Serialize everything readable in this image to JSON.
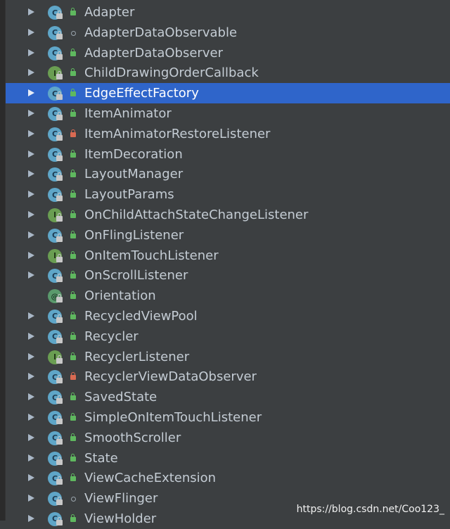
{
  "tree": {
    "items": [
      {
        "label": "Adapter",
        "icon": "class-icon",
        "icon_letter": "C",
        "visibility": "public",
        "expandable": true,
        "selected": false
      },
      {
        "label": "AdapterDataObservable",
        "icon": "class-icon",
        "icon_letter": "C",
        "visibility": "package",
        "expandable": true,
        "selected": false
      },
      {
        "label": "AdapterDataObserver",
        "icon": "class-icon",
        "icon_letter": "C",
        "visibility": "public",
        "expandable": true,
        "selected": false
      },
      {
        "label": "ChildDrawingOrderCallback",
        "icon": "interface-icon",
        "icon_letter": "I",
        "visibility": "public",
        "expandable": true,
        "selected": false
      },
      {
        "label": "EdgeEffectFactory",
        "icon": "class-icon",
        "icon_letter": "C",
        "visibility": "public",
        "expandable": true,
        "selected": true
      },
      {
        "label": "ItemAnimator",
        "icon": "class-icon",
        "icon_letter": "C",
        "visibility": "public",
        "expandable": true,
        "selected": false
      },
      {
        "label": "ItemAnimatorRestoreListener",
        "icon": "class-icon",
        "icon_letter": "C",
        "visibility": "private",
        "expandable": true,
        "selected": false
      },
      {
        "label": "ItemDecoration",
        "icon": "class-icon",
        "icon_letter": "C",
        "visibility": "public",
        "expandable": true,
        "selected": false
      },
      {
        "label": "LayoutManager",
        "icon": "class-icon",
        "icon_letter": "C",
        "visibility": "public",
        "expandable": true,
        "selected": false
      },
      {
        "label": "LayoutParams",
        "icon": "class-icon",
        "icon_letter": "C",
        "visibility": "public",
        "expandable": true,
        "selected": false
      },
      {
        "label": "OnChildAttachStateChangeListener",
        "icon": "interface-icon",
        "icon_letter": "I",
        "visibility": "public",
        "expandable": true,
        "selected": false
      },
      {
        "label": "OnFlingListener",
        "icon": "class-icon",
        "icon_letter": "C",
        "visibility": "public",
        "expandable": true,
        "selected": false
      },
      {
        "label": "OnItemTouchListener",
        "icon": "interface-icon",
        "icon_letter": "I",
        "visibility": "public",
        "expandable": true,
        "selected": false
      },
      {
        "label": "OnScrollListener",
        "icon": "class-icon",
        "icon_letter": "C",
        "visibility": "public",
        "expandable": true,
        "selected": false
      },
      {
        "label": "Orientation",
        "icon": "annotation-icon",
        "icon_letter": "@",
        "visibility": "public",
        "expandable": false,
        "selected": false
      },
      {
        "label": "RecycledViewPool",
        "icon": "class-icon",
        "icon_letter": "C",
        "visibility": "public",
        "expandable": true,
        "selected": false
      },
      {
        "label": "Recycler",
        "icon": "class-icon",
        "icon_letter": "C",
        "visibility": "public",
        "expandable": true,
        "selected": false
      },
      {
        "label": "RecyclerListener",
        "icon": "interface-icon",
        "icon_letter": "I",
        "visibility": "public",
        "expandable": true,
        "selected": false
      },
      {
        "label": "RecyclerViewDataObserver",
        "icon": "class-icon",
        "icon_letter": "C",
        "visibility": "private",
        "expandable": true,
        "selected": false
      },
      {
        "label": "SavedState",
        "icon": "class-icon",
        "icon_letter": "C",
        "visibility": "public",
        "expandable": true,
        "selected": false
      },
      {
        "label": "SimpleOnItemTouchListener",
        "icon": "class-icon",
        "icon_letter": "C",
        "visibility": "public",
        "expandable": true,
        "selected": false
      },
      {
        "label": "SmoothScroller",
        "icon": "class-icon",
        "icon_letter": "C",
        "visibility": "public",
        "expandable": true,
        "selected": false
      },
      {
        "label": "State",
        "icon": "class-icon",
        "icon_letter": "C",
        "visibility": "public",
        "expandable": true,
        "selected": false
      },
      {
        "label": "ViewCacheExtension",
        "icon": "class-icon",
        "icon_letter": "C",
        "visibility": "public",
        "expandable": true,
        "selected": false
      },
      {
        "label": "ViewFlinger",
        "icon": "class-icon",
        "icon_letter": "C",
        "visibility": "package",
        "expandable": true,
        "selected": false
      },
      {
        "label": "ViewHolder",
        "icon": "class-icon",
        "icon_letter": "C",
        "visibility": "public",
        "expandable": true,
        "selected": false
      }
    ]
  },
  "watermark": "https://blog.csdn.net/Coo123_",
  "colors": {
    "background": "#3c3f41",
    "selection": "#2f65ca",
    "text": "#c4ccd4",
    "class_icon": "#5fa6c8",
    "interface_icon": "#6a9e52",
    "public_lock": "#5fb85f",
    "private_lock": "#d96a52"
  }
}
